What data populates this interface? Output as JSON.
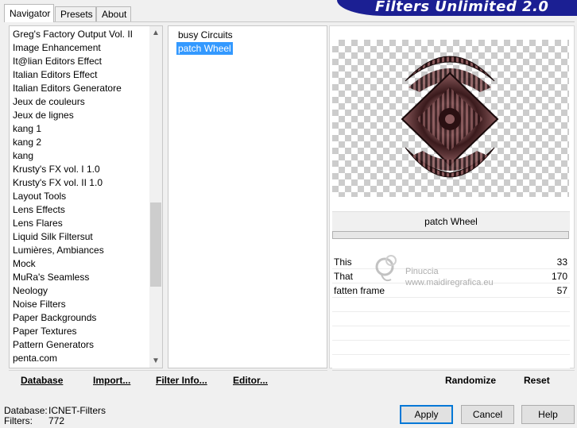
{
  "header": {
    "title": "Filters Unlimited 2.0"
  },
  "tabs": [
    {
      "label": "Navigator",
      "active": true
    },
    {
      "label": "Presets",
      "active": false
    },
    {
      "label": "About",
      "active": false
    }
  ],
  "categories": [
    "Greg's Factory Output Vol. II",
    "Image Enhancement",
    "It@lian Editors Effect",
    "Italian Editors Effect",
    "Italian Editors Generatore",
    "Jeux de couleurs",
    "Jeux de lignes",
    "kang 1",
    "kang 2",
    "kang",
    "Krusty's FX vol. I 1.0",
    "Krusty's FX vol. II 1.0",
    "Layout Tools",
    "Lens Effects",
    "Lens Flares",
    "Liquid Silk Filtersut",
    "Lumières, Ambiances",
    "Mock",
    "MuRa's Seamless",
    "Neology",
    "Noise Filters",
    "Paper Backgrounds",
    "Paper Textures",
    "Pattern Generators",
    "penta.com"
  ],
  "filters": [
    {
      "label": "busy Circuits",
      "selected": false
    },
    {
      "label": "patch Wheel",
      "selected": true
    }
  ],
  "preview": {
    "filter_name": "patch Wheel"
  },
  "params": [
    {
      "label": "This",
      "value": "33"
    },
    {
      "label": "That",
      "value": "170"
    },
    {
      "label": "fatten frame",
      "value": "57"
    }
  ],
  "watermark": {
    "line1": "Pinuccia",
    "line2": "www.maidiregrafica.eu"
  },
  "left_buttons": {
    "database": "Database",
    "import": "Import...",
    "filter_info": "Filter Info...",
    "editor": "Editor..."
  },
  "right_buttons": {
    "randomize": "Randomize",
    "reset": "Reset"
  },
  "status": {
    "database_label": "Database:",
    "database_value": "ICNET-Filters",
    "filters_label": "Filters:",
    "filters_value": "772"
  },
  "dialog_buttons": {
    "apply": "Apply",
    "cancel": "Cancel",
    "help": "Help"
  },
  "colors": {
    "banner": "#1b1f93",
    "selection": "#3399ff",
    "default_button_border": "#0078d7"
  }
}
